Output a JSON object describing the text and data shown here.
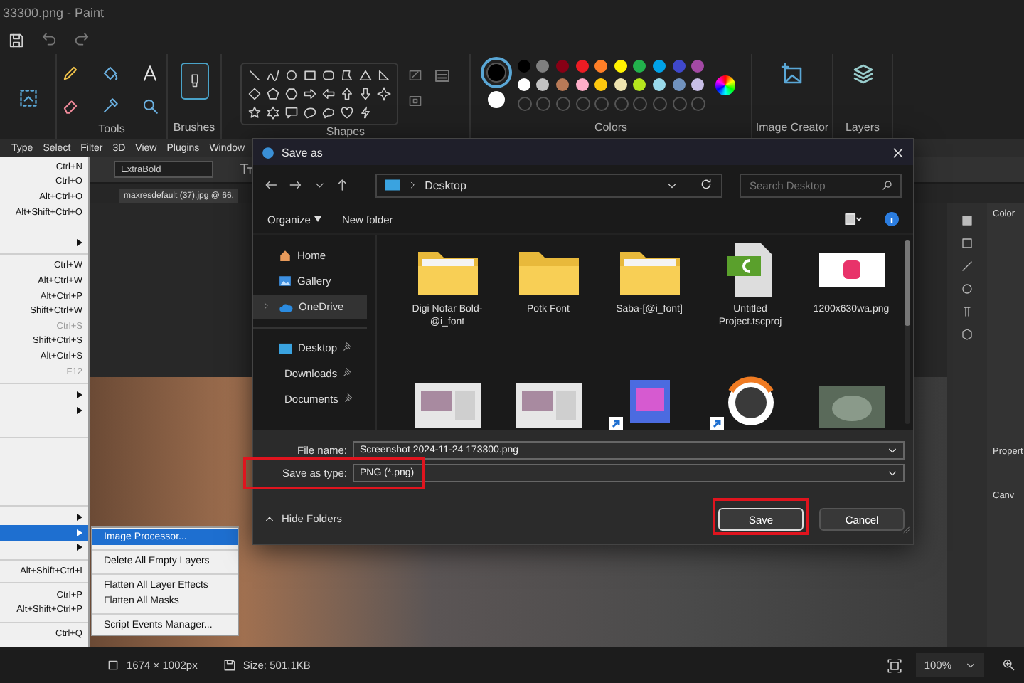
{
  "paint": {
    "title": "33300.png - Paint",
    "ribbon": {
      "tools_label": "Tools",
      "brushes_label": "Brushes",
      "shapes_label": "Shapes",
      "colors_label": "Colors",
      "image_creator_label": "Image Creator",
      "layers_label": "Layers"
    },
    "colors": {
      "primary": {
        "color": "#000000",
        "selected": true
      },
      "secondary": {
        "color": "#ffffff",
        "selected": false
      },
      "palette": [
        {
          "color": "#000000"
        },
        {
          "color": "#7f7f7f"
        },
        {
          "color": "#880015"
        },
        {
          "color": "#ed1c24"
        },
        {
          "color": "#ff7f27"
        },
        {
          "color": "#fff200"
        },
        {
          "color": "#22b14c"
        },
        {
          "color": "#00a2e8"
        },
        {
          "color": "#3f48cc"
        },
        {
          "color": "#a349a4"
        },
        {
          "color": "#ffffff"
        },
        {
          "color": "#c3c3c3"
        },
        {
          "color": "#b97a57"
        },
        {
          "color": "#ffaec9"
        },
        {
          "color": "#ffc90e"
        },
        {
          "color": "#efe4b0"
        },
        {
          "color": "#b5e61d"
        },
        {
          "color": "#99d9ea"
        },
        {
          "color": "#7092be"
        },
        {
          "color": "#c8bfe7"
        }
      ]
    },
    "status_bar": {
      "dimensions": "1674 × 1002px",
      "size": "Size: 501.1KB",
      "zoom": "100%"
    }
  },
  "photoshop": {
    "menu_bar": [
      "Type",
      "Select",
      "Filter",
      "3D",
      "View",
      "Plugins",
      "Window"
    ],
    "font_style": "ExtraBold",
    "tab": "maxresdefault (37).jpg @ 66.",
    "panels": {
      "color_panel": "Color",
      "properties_panel": "Propert",
      "canvas_panel": "Canv"
    },
    "file_menu": [
      {
        "kind": "item",
        "shortcut": "Ctrl+N",
        "disabled": false,
        "selected": false,
        "submenu": false
      },
      {
        "kind": "item",
        "shortcut": "Ctrl+O",
        "disabled": false,
        "selected": false,
        "submenu": false
      },
      {
        "kind": "item",
        "shortcut": "Alt+Ctrl+O",
        "disabled": false,
        "selected": false,
        "submenu": false
      },
      {
        "kind": "item",
        "shortcut": "Alt+Shift+Ctrl+O",
        "disabled": false,
        "selected": false,
        "submenu": false
      },
      {
        "kind": "spacer"
      },
      {
        "kind": "item",
        "disabled": false,
        "selected": false,
        "submenu": true
      },
      {
        "kind": "separator"
      },
      {
        "kind": "item",
        "shortcut": "Ctrl+W",
        "disabled": false,
        "selected": false,
        "submenu": false
      },
      {
        "kind": "item",
        "shortcut": "Alt+Ctrl+W",
        "disabled": false,
        "selected": false,
        "submenu": false
      },
      {
        "kind": "item",
        "shortcut": "Alt+Ctrl+P",
        "disabled": false,
        "selected": false,
        "submenu": false
      },
      {
        "kind": "item",
        "shortcut": "Shift+Ctrl+W",
        "disabled": false,
        "selected": false,
        "submenu": false
      },
      {
        "kind": "item",
        "shortcut": "Ctrl+S",
        "disabled": true,
        "selected": false,
        "submenu": false
      },
      {
        "kind": "item",
        "shortcut": "Shift+Ctrl+S",
        "disabled": false,
        "selected": false,
        "submenu": false
      },
      {
        "kind": "item",
        "shortcut": "Alt+Ctrl+S",
        "disabled": false,
        "selected": false,
        "submenu": false
      },
      {
        "kind": "item",
        "shortcut": "F12",
        "disabled": true,
        "selected": false,
        "submenu": false
      },
      {
        "kind": "separator"
      },
      {
        "kind": "item",
        "disabled": false,
        "selected": false,
        "submenu": true
      },
      {
        "kind": "item",
        "disabled": false,
        "selected": false,
        "submenu": true
      },
      {
        "kind": "spacer"
      },
      {
        "kind": "separator"
      },
      {
        "kind": "spacer"
      },
      {
        "kind": "spacer"
      },
      {
        "kind": "spacer"
      },
      {
        "kind": "spacer"
      },
      {
        "kind": "separator"
      },
      {
        "kind": "item",
        "disabled": false,
        "selected": false,
        "submenu": true
      },
      {
        "kind": "item",
        "disabled": false,
        "selected": true,
        "submenu": true
      },
      {
        "kind": "item",
        "disabled": false,
        "selected": false,
        "submenu": true
      },
      {
        "kind": "separator"
      },
      {
        "kind": "item",
        "shortcut": "Alt+Shift+Ctrl+I",
        "disabled": false,
        "selected": false,
        "submenu": false
      },
      {
        "kind": "separator"
      },
      {
        "kind": "item",
        "shortcut": "Ctrl+P",
        "disabled": false,
        "selected": false,
        "submenu": false
      },
      {
        "kind": "item",
        "shortcut": "Alt+Shift+Ctrl+P",
        "disabled": false,
        "selected": false,
        "submenu": false
      },
      {
        "kind": "separator"
      },
      {
        "kind": "item",
        "shortcut": "Ctrl+Q",
        "disabled": false,
        "selected": false,
        "submenu": false
      }
    ],
    "submenu": [
      {
        "kind": "item",
        "label": "Image Processor...",
        "selected": true
      },
      {
        "kind": "separator"
      },
      {
        "kind": "item",
        "label": "Delete All Empty Layers",
        "selected": false
      },
      {
        "kind": "separator"
      },
      {
        "kind": "item",
        "label": "Flatten All Layer Effects",
        "selected": false
      },
      {
        "kind": "item",
        "label": "Flatten All Masks",
        "selected": false
      },
      {
        "kind": "separator"
      },
      {
        "kind": "item",
        "label": "Script Events Manager...",
        "selected": false
      }
    ]
  },
  "dialog": {
    "title": "Save as",
    "address": "Desktop",
    "search_placeholder": "Search Desktop",
    "organize": "Organize",
    "new_folder": "New folder",
    "sidebar": [
      {
        "kind": "home",
        "label": "Home",
        "selected": false,
        "pinned": false,
        "expandable": false
      },
      {
        "kind": "gallery",
        "label": "Gallery",
        "selected": false,
        "pinned": false,
        "expandable": false
      },
      {
        "kind": "cloud",
        "label": "OneDrive",
        "selected": true,
        "pinned": false,
        "expandable": true
      },
      {
        "kind": "separator"
      },
      {
        "kind": "desktop",
        "label": "Desktop",
        "selected": false,
        "pinned": true,
        "expandable": false
      },
      {
        "kind": "download",
        "label": "Downloads",
        "selected": false,
        "pinned": true,
        "expandable": false
      },
      {
        "kind": "document",
        "label": "Documents",
        "selected": false,
        "pinned": true,
        "expandable": false
      }
    ],
    "files": [
      {
        "kind": "folder-doc",
        "name": "Digi Nofar Bold-@i_font",
        "shortcut": false
      },
      {
        "kind": "folder",
        "name": "Potk Font",
        "shortcut": false
      },
      {
        "kind": "folder-doc",
        "name": "Saba-[@i_font]",
        "shortcut": false
      },
      {
        "kind": "project",
        "name": "Untitled Project.tscproj",
        "shortcut": false
      },
      {
        "kind": "logo-image",
        "name": "1200x630wa.png",
        "shortcut": false
      },
      {
        "kind": "screenshot",
        "shortcut": false
      },
      {
        "kind": "screenshot",
        "shortcut": false
      },
      {
        "kind": "game-icon",
        "shortcut": true
      },
      {
        "kind": "ring-logo",
        "shortcut": true
      },
      {
        "kind": "photo",
        "shortcut": false
      }
    ],
    "file_name": {
      "label": "File name:",
      "value": "Screenshot 2024-11-24 173300.png",
      "highlighted": false
    },
    "save_type": {
      "label": "Save as type:",
      "value": "PNG (*.png)",
      "highlighted": true
    },
    "hide_folders": "Hide Folders",
    "buttons": [
      {
        "kind": "primary",
        "label": "Save",
        "highlighted": true
      },
      {
        "kind": "secondary",
        "label": "Cancel",
        "highlighted": false
      }
    ]
  }
}
